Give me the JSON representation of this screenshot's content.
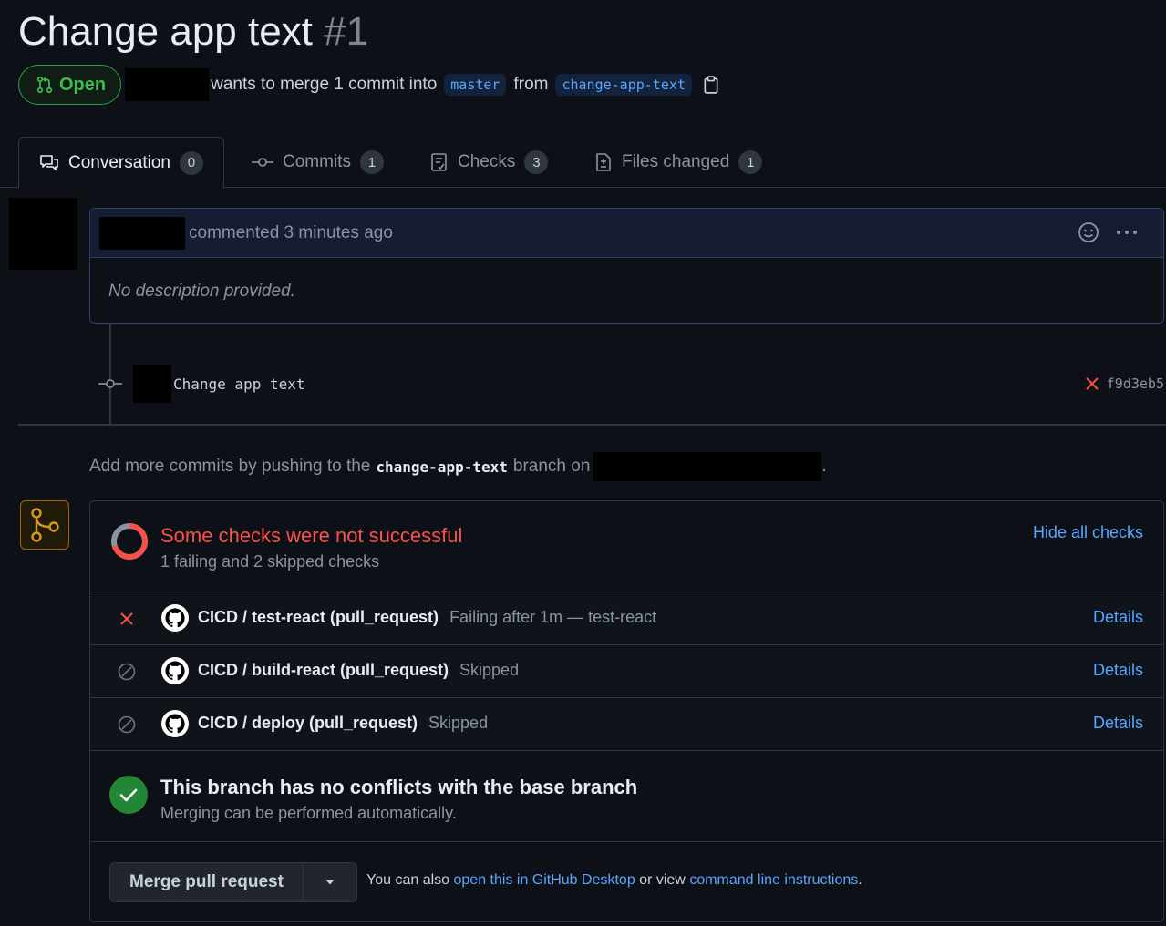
{
  "pr": {
    "title": "Change app text",
    "number": "#1",
    "state": "Open",
    "merge_text": "wants to merge 1 commit into",
    "base_branch": "master",
    "from_text": "from",
    "head_branch": "change-app-text"
  },
  "tabs": [
    {
      "label": "Conversation",
      "count": "0"
    },
    {
      "label": "Commits",
      "count": "1"
    },
    {
      "label": "Checks",
      "count": "3"
    },
    {
      "label": "Files changed",
      "count": "1"
    }
  ],
  "comment": {
    "meta": "commented 3 minutes ago",
    "body": "No description provided."
  },
  "commit": {
    "message": "Change app text",
    "sha": "f9d3eb5"
  },
  "push_note": {
    "prefix": "Add more commits by pushing to the",
    "branch": "change-app-text",
    "suffix": "branch on",
    "end": "."
  },
  "checks": {
    "title": "Some checks were not successful",
    "subtitle": "1 failing and 2 skipped checks",
    "hide_label": "Hide all checks",
    "items": [
      {
        "status": "failure",
        "name": "CICD / test-react (pull_request)",
        "desc": "Failing after 1m — test-react",
        "link": "Details"
      },
      {
        "status": "skipped",
        "name": "CICD / build-react (pull_request)",
        "desc": "Skipped",
        "link": "Details"
      },
      {
        "status": "skipped",
        "name": "CICD / deploy (pull_request)",
        "desc": "Skipped",
        "link": "Details"
      }
    ]
  },
  "conflicts": {
    "title": "This branch has no conflicts with the base branch",
    "subtitle": "Merging can be performed automatically."
  },
  "merge": {
    "button_label": "Merge pull request",
    "also_text": "You can also",
    "desktop_link": "open this in GitHub Desktop",
    "or_text": "or view",
    "cli_link": "command line instructions",
    "end": "."
  },
  "colors": {
    "open_green": "#3fb950",
    "fail_red": "#f85149",
    "link_blue": "#58a6ff",
    "background": "#0d1117"
  }
}
